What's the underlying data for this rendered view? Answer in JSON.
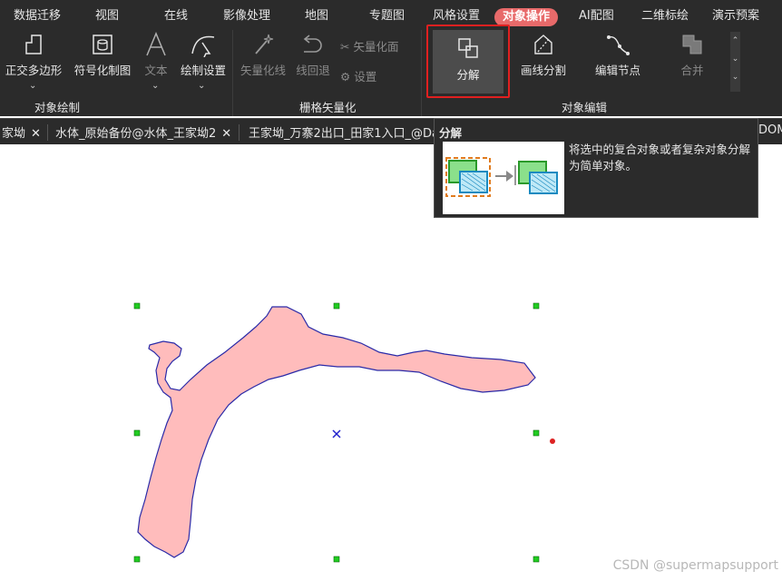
{
  "menu": {
    "items": [
      "数据迁移",
      "视图",
      "在线",
      "影像处理",
      "地图",
      "专题图",
      "风格设置",
      "对象操作",
      "AI配图",
      "二维标绘",
      "演示预案"
    ],
    "active_index": 7
  },
  "ribbon": {
    "draw_group": {
      "label": "对象绘制",
      "buttons": [
        "正交多边形",
        "符号化制图",
        "文本",
        "绘制设置"
      ]
    },
    "raster_group": {
      "label": "栅格矢量化",
      "buttons": [
        "矢量化线",
        "线回退"
      ],
      "small_buttons": [
        "矢量化面",
        "设置"
      ]
    },
    "edit_group": {
      "label": "对象编辑",
      "buttons": [
        "分解",
        "画线分割",
        "编辑节点",
        "合并"
      ]
    }
  },
  "tabs": [
    {
      "label": "家坳",
      "closable": true
    },
    {
      "label": "水体_原始备份@水体_王家坳2",
      "closable": true
    },
    {
      "label": "王家坳_万寨2出口_田家1入口_@Da",
      "closable": false
    },
    {
      "label": "DOM",
      "closable": false
    }
  ],
  "tooltip": {
    "title": "分解",
    "description": "将选中的复合对象或者复杂对象分解为简单对象。"
  },
  "watermark": "CSDN @supermapsupport",
  "colors": {
    "accent": "#e86a6a",
    "highlight": "#e02020",
    "polygon_fill": "#ffbcbc",
    "polygon_stroke": "#2a2aa8",
    "handle": "#22cc22",
    "anchor": "#dd2222"
  }
}
